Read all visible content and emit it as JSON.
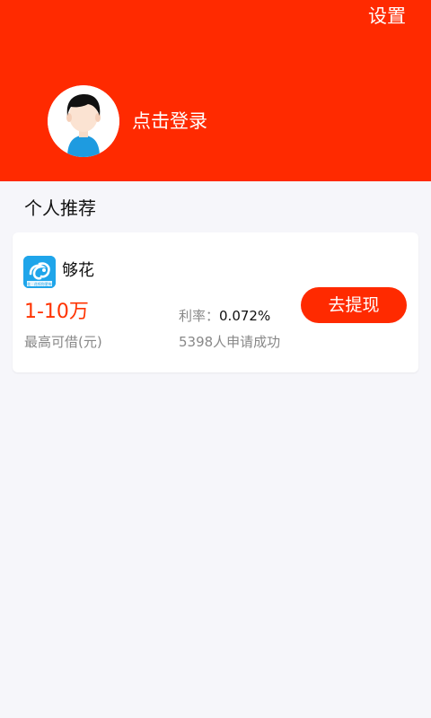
{
  "header": {
    "settings_label": "设置",
    "login_label": "点击登录",
    "background_color": "#ff2a00"
  },
  "avatar": {
    "icon": "user-avatar-icon"
  },
  "section": {
    "title": "个人推荐"
  },
  "recommendation": {
    "app_icon": "app-logo-icon",
    "app_icon_text": "够花 · 花呗你更有翼",
    "app_name": "够花",
    "amount": "1-10万",
    "amount_label": "最高可借(元)",
    "rate_label": "利率：",
    "rate_value": "0.072%",
    "applied_text": "5398人申请成功",
    "cta_label": "去提现",
    "accent_color": "#ff3300"
  }
}
